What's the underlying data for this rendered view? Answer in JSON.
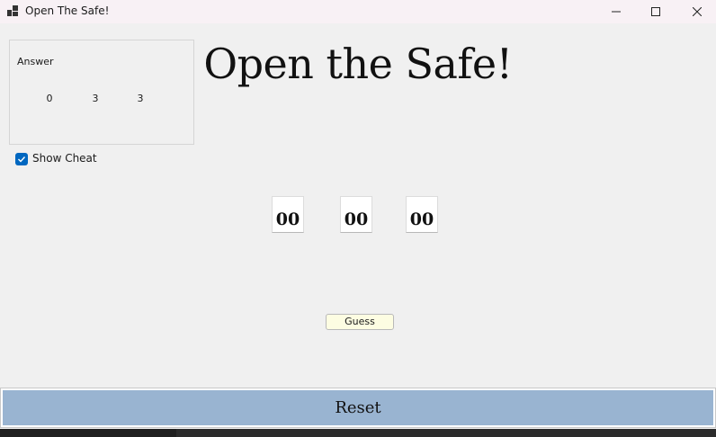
{
  "window": {
    "title": "Open The Safe!",
    "icon": "app-window-icon",
    "controls": [
      "minimize-icon",
      "maximize-icon",
      "close-icon"
    ]
  },
  "answer_group": {
    "legend": "Answer",
    "digits": [
      "0",
      "3",
      "3"
    ]
  },
  "cheat": {
    "label": "Show Cheat",
    "checked": true
  },
  "heading": "Open the Safe!",
  "guess_digits": [
    "00",
    "00",
    "00"
  ],
  "guess_button": {
    "label": "Guess"
  },
  "reset_button": {
    "label": "Reset"
  },
  "colors": {
    "accent": "#0067c0",
    "reset_bg": "#99b4d1",
    "guess_bg": "#fdfde2",
    "window_bg": "#f0f0f0"
  }
}
